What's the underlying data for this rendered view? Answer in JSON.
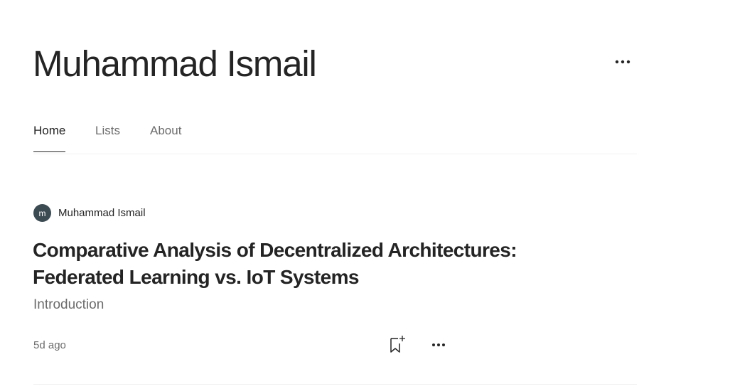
{
  "profile": {
    "name": "Muhammad Ismail",
    "more_icon": "ellipsis-icon"
  },
  "tabs": [
    {
      "label": "Home",
      "active": true
    },
    {
      "label": "Lists",
      "active": false
    },
    {
      "label": "About",
      "active": false
    }
  ],
  "post": {
    "author": {
      "initial": "m",
      "name": "Muhammad Ismail"
    },
    "title": "Comparative Analysis of Decentralized Architectures: Federated Learning vs. IoT Systems",
    "subtitle": "Introduction",
    "date": "5d ago",
    "bookmark_icon": "bookmark-add-icon",
    "more_icon": "ellipsis-icon"
  },
  "colors": {
    "text": "#242424",
    "muted": "#6b6b6b",
    "border": "#f2f2f2",
    "avatar_bg": "#3c4a52"
  }
}
